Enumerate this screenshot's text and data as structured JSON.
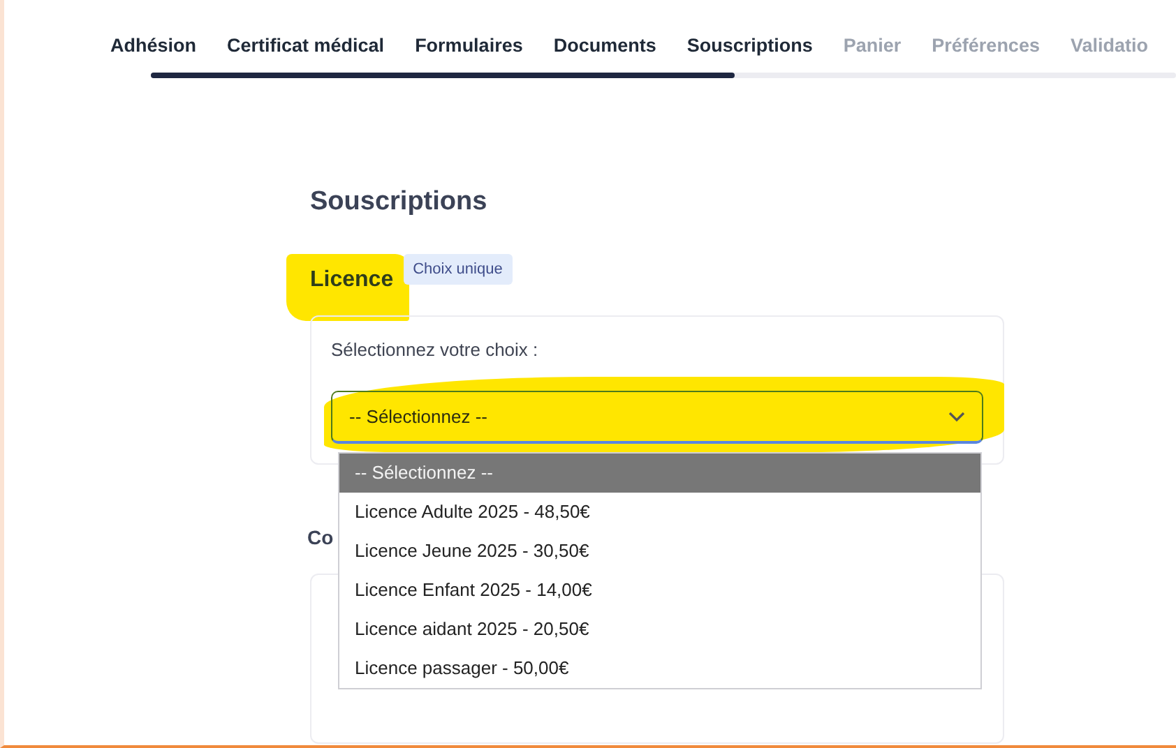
{
  "steps": [
    {
      "label": "Adhésion",
      "reached": true
    },
    {
      "label": "Certificat médical",
      "reached": true
    },
    {
      "label": "Formulaires",
      "reached": true
    },
    {
      "label": "Documents",
      "reached": true
    },
    {
      "label": "Souscriptions",
      "reached": true
    },
    {
      "label": "Panier",
      "reached": false
    },
    {
      "label": "Préférences",
      "reached": false
    },
    {
      "label": "Validatio",
      "reached": false
    }
  ],
  "progress": {
    "level": 0.57
  },
  "page_title": "Souscriptions",
  "section": {
    "title": "Licence",
    "badge": "Choix unique",
    "highlighted": true,
    "prompt": "Sélectionnez votre choix :",
    "select": {
      "value": "-- Sélectionnez --",
      "highlighted": true,
      "expanded": true,
      "options": [
        {
          "label": "-- Sélectionnez --",
          "selected": true
        },
        {
          "label": "Licence Adulte 2025 - 48,50€",
          "selected": false
        },
        {
          "label": "Licence Jeune 2025 - 30,50€",
          "selected": false
        },
        {
          "label": "Licence Enfant 2025 - 14,00€",
          "selected": false
        },
        {
          "label": "Licence aidant 2025 - 20,50€",
          "selected": false
        },
        {
          "label": "Licence passager - 50,00€",
          "selected": false
        }
      ]
    }
  },
  "next_section": {
    "title": "Co"
  }
}
